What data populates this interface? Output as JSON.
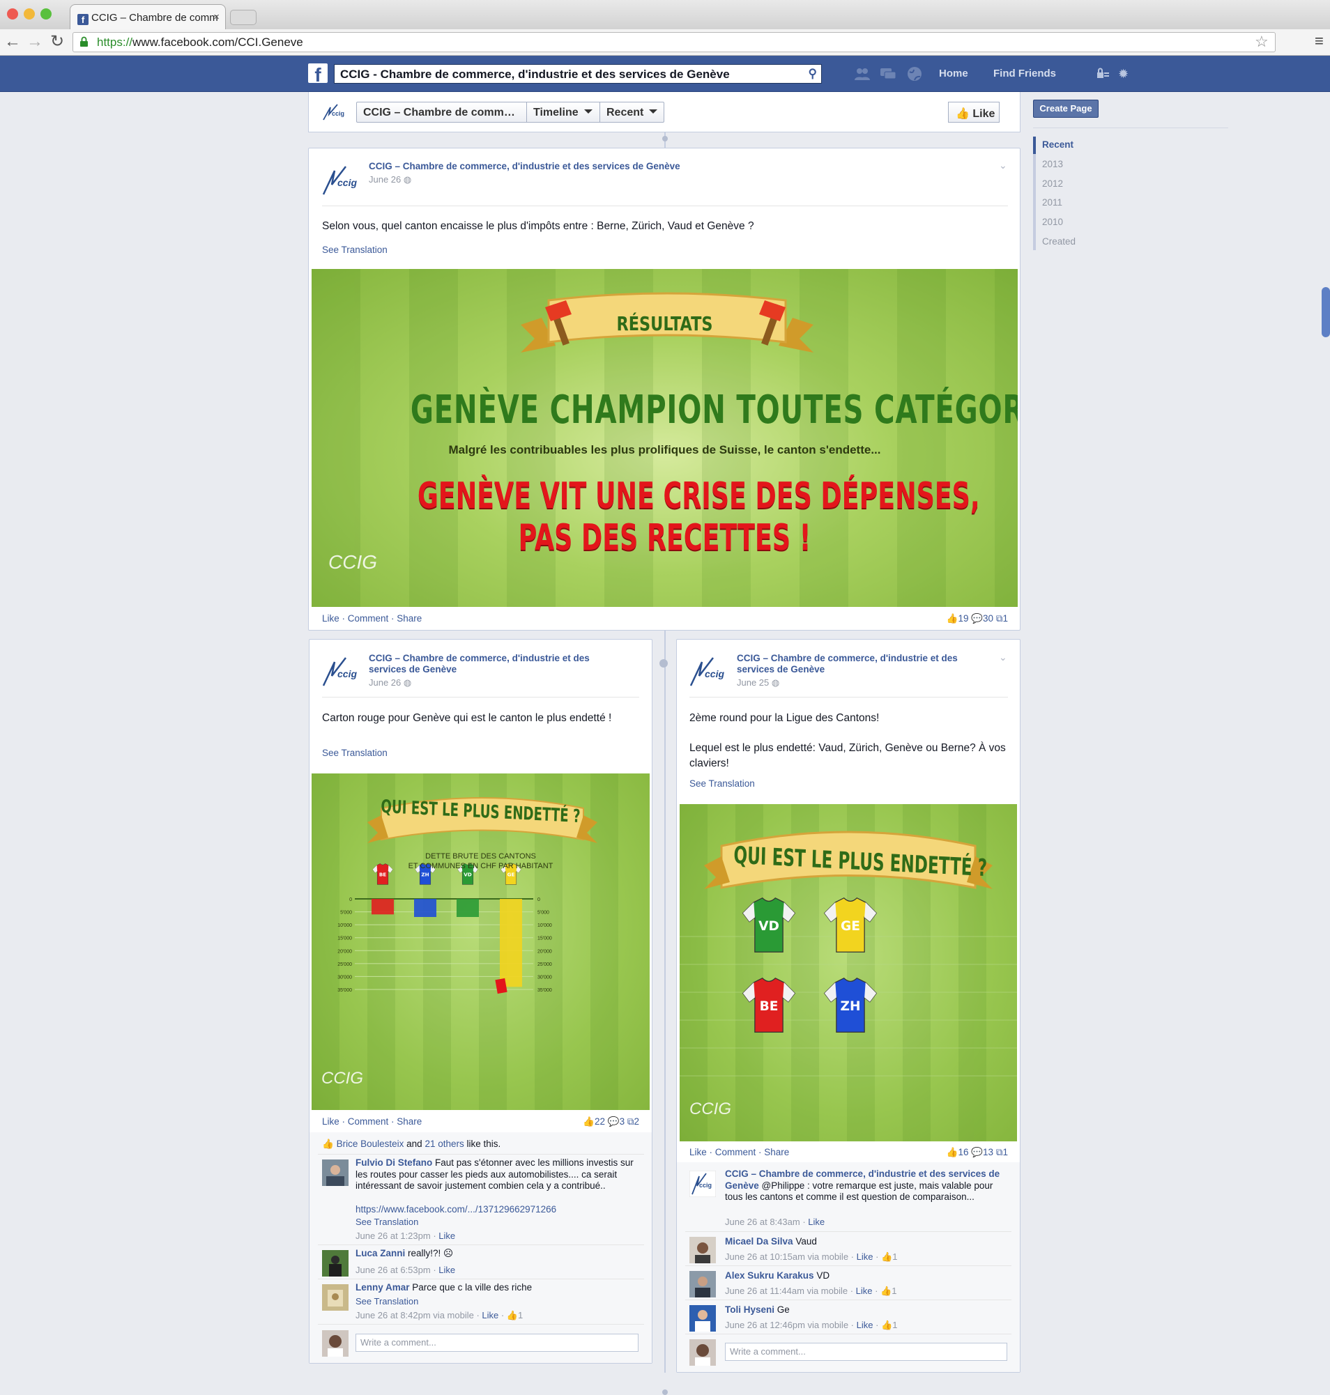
{
  "browser": {
    "tab_title": "CCIG – Chambre de comm",
    "tab_close": "×",
    "url_scheme": "https://",
    "url_rest": "www.facebook.com/CCI.Geneve"
  },
  "fb": {
    "search_value": "CCIG - Chambre de commerce, d'industrie et des services de Genève",
    "nav_home": "Home",
    "nav_find_friends": "Find Friends",
    "logo": "f"
  },
  "timeline_nav": {
    "page_select": "CCIG – Chambre de comm…",
    "timeline": "Timeline",
    "recent": "Recent",
    "like": "Like"
  },
  "sidebar": {
    "create_page": "Create Page",
    "years": [
      "Recent",
      "2013",
      "2012",
      "2011",
      "2010",
      "Created"
    ]
  },
  "common": {
    "see_translation": "See Translation",
    "actions": "Like · Comment · Share",
    "write_comment": "Write a comment...",
    "page_avatar": "CCIG"
  },
  "post1": {
    "author": "CCIG – Chambre de commerce, d'industrie et des services de Genève",
    "date": "June 26",
    "text": "Selon vous, quel canton encaisse le plus d'impôts entre : Berne, Zürich, Vaud et Genève ?",
    "image": {
      "banner": "RÉSULTATS",
      "headline": "GENÈVE CHAMPION TOUTES CATÉGORIES",
      "subline": "Malgré les contribuables les plus prolifiques de Suisse, le canton s'endette...",
      "red_line1": "GENÈVE VIT UNE CRISE DES DÉPENSES,",
      "red_line2": "PAS DES RECETTES !",
      "logo": "CCIG"
    },
    "likes": "19",
    "comments": "30",
    "shares": "1"
  },
  "post2": {
    "author_line1": "CCIG – Chambre de commerce, d'industrie et des",
    "author_line2": "services de Genève",
    "date": "June 26",
    "text": "Carton rouge pour Genève qui est le canton le plus endetté !",
    "image": {
      "banner": "QUI EST LE PLUS ENDETTÉ ?",
      "subtitle1": "DETTE BRUTE DES CANTONS",
      "subtitle2": "ET COMMUNES EN CHF PAR HABITANT",
      "logo": "CCIG"
    },
    "likes": "22",
    "comments": "3",
    "shares": "2",
    "likers_name": "Brice Boulesteix",
    "likers_and": "and",
    "likers_others": "21 others",
    "likers_tail": "like this.",
    "comment_list": [
      {
        "name": "Fulvio Di Stefano",
        "text": "Faut pas s'étonner avec les millions investis sur les routes pour casser les pieds aux automobilistes.... ca serait intéressant de savoir justement combien cela y a contribué..",
        "link": "https://www.facebook.com/.../137129662971266",
        "see_translation": "See Translation",
        "time": "June 26 at 1:23pm",
        "sep": " · ",
        "like": "Like",
        "likes": ""
      },
      {
        "name": "Luca Zanni",
        "text": "really!?! ☹",
        "time": "June 26 at 6:53pm",
        "sep": " · ",
        "like": "Like",
        "likes": ""
      },
      {
        "name": "Lenny Amar",
        "text": "Parce que c la ville des riche",
        "see_translation": "See Translation",
        "time": "June 26 at 8:42pm via mobile",
        "sep": " · ",
        "like": "Like",
        "likes": " · 👍1"
      }
    ]
  },
  "post3": {
    "author_line1": "CCIG – Chambre de commerce, d'industrie et des",
    "author_line2": "services de Genève",
    "date": "June 25",
    "text_line1": "2ème round pour la Ligue des Cantons!",
    "text_line2": "Lequel est le plus endetté: Vaud, Zürich, Genève ou Berne? À vos claviers!",
    "image": {
      "banner": "QUI EST LE PLUS ENDETTÉ ?",
      "logo": "CCIG"
    },
    "likes": "16",
    "comments": "13",
    "shares": "1",
    "comment_list": [
      {
        "name": "CCIG – Chambre de commerce, d'industrie et des services de Genève",
        "text": "@Philippe : votre remarque est juste, mais valable pour tous les cantons et comme il est question de comparaison...",
        "time": "June 26 at 8:43am",
        "sep": " · ",
        "like": "Like",
        "likes": ""
      },
      {
        "name": "Micael Da Silva",
        "text": "Vaud",
        "time": "June 26 at 10:15am via mobile",
        "sep": " · ",
        "like": "Like",
        "likes": " · 👍1"
      },
      {
        "name": "Alex Sukru Karakus",
        "text": "VD",
        "time": "June 26 at 11:44am via mobile",
        "sep": " · ",
        "like": "Like",
        "likes": " · 👍1"
      },
      {
        "name": "Toli Hyseni",
        "text": "Ge",
        "time": "June 26 at 12:46pm via mobile",
        "sep": " · ",
        "like": "Like",
        "likes": " · 👍1"
      }
    ]
  },
  "chart": {
    "cantons": [
      "BE",
      "ZH",
      "VD",
      "GE"
    ],
    "jersey_colors": [
      "#e02020",
      "#1f4fd6",
      "#2a9a35",
      "#f2d41f"
    ],
    "tick_labels": [
      "0",
      "5'000",
      "10'000",
      "15'000",
      "20'000",
      "25'000",
      "30'000",
      "35'000"
    ],
    "values": [
      6000,
      7000,
      7000,
      34000
    ],
    "max": 35000
  },
  "colors": {
    "fb_blue": "#3b5998",
    "grass": "#8fc04a",
    "headline_green": "#2f7a1c",
    "headline_red": "#e3161b"
  }
}
